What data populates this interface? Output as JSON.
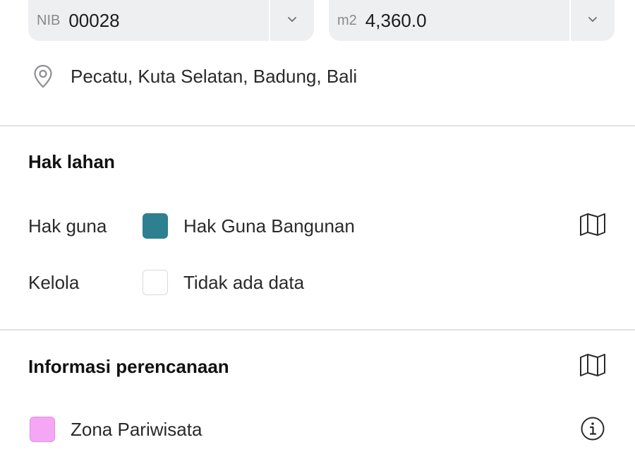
{
  "nib_field": {
    "prefix": "NIB",
    "value": "00028"
  },
  "area_field": {
    "prefix": "m2",
    "value": "4,360.0"
  },
  "location": {
    "text": "Pecatu, Kuta Selatan, Badung, Bali",
    "icon": "location-pin-icon"
  },
  "land_rights": {
    "title": "Hak lahan",
    "rows": [
      {
        "label": "Hak guna",
        "value": "Hak Guna Bangunan",
        "swatch_color": "#2e7f8f"
      },
      {
        "label": "Kelola",
        "value": "Tidak ada data",
        "swatch_color": "#ffffff"
      }
    ]
  },
  "planning": {
    "title": "Informasi perencanaan",
    "zone": {
      "value": "Zona Pariwisata",
      "swatch_color": "#f5a7f5"
    }
  },
  "icons": {
    "chevron": "chevron-down-icon",
    "map": "map-icon",
    "info": "info-icon"
  }
}
